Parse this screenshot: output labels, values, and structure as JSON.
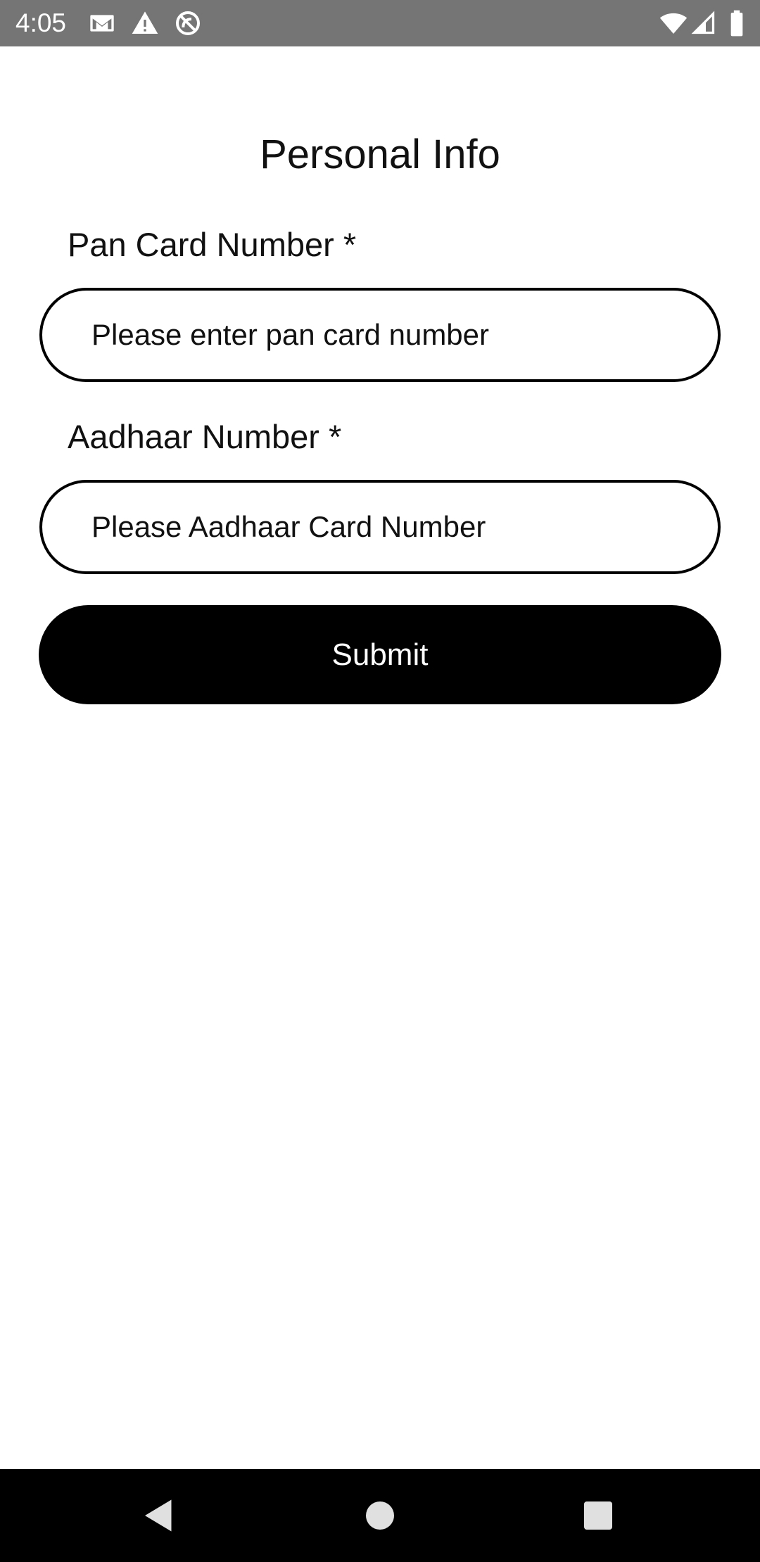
{
  "status_bar": {
    "time": "4:05",
    "icons_left": [
      "gmail-icon",
      "warning-icon",
      "no-sync-icon"
    ],
    "icons_right": [
      "wifi-icon",
      "cell-signal-icon",
      "battery-icon"
    ],
    "background": "#757575"
  },
  "page": {
    "title": "Personal Info"
  },
  "form": {
    "pan": {
      "label": "Pan Card Number *",
      "placeholder": "Please enter pan card number",
      "value": ""
    },
    "aadhaar": {
      "label": "Aadhaar Number *",
      "placeholder": "Please Aadhaar Card Number",
      "value": ""
    },
    "submit_label": "Submit",
    "submit_color": "#000000"
  },
  "nav_bar": {
    "buttons": [
      "back-icon",
      "home-icon",
      "recents-icon"
    ]
  }
}
